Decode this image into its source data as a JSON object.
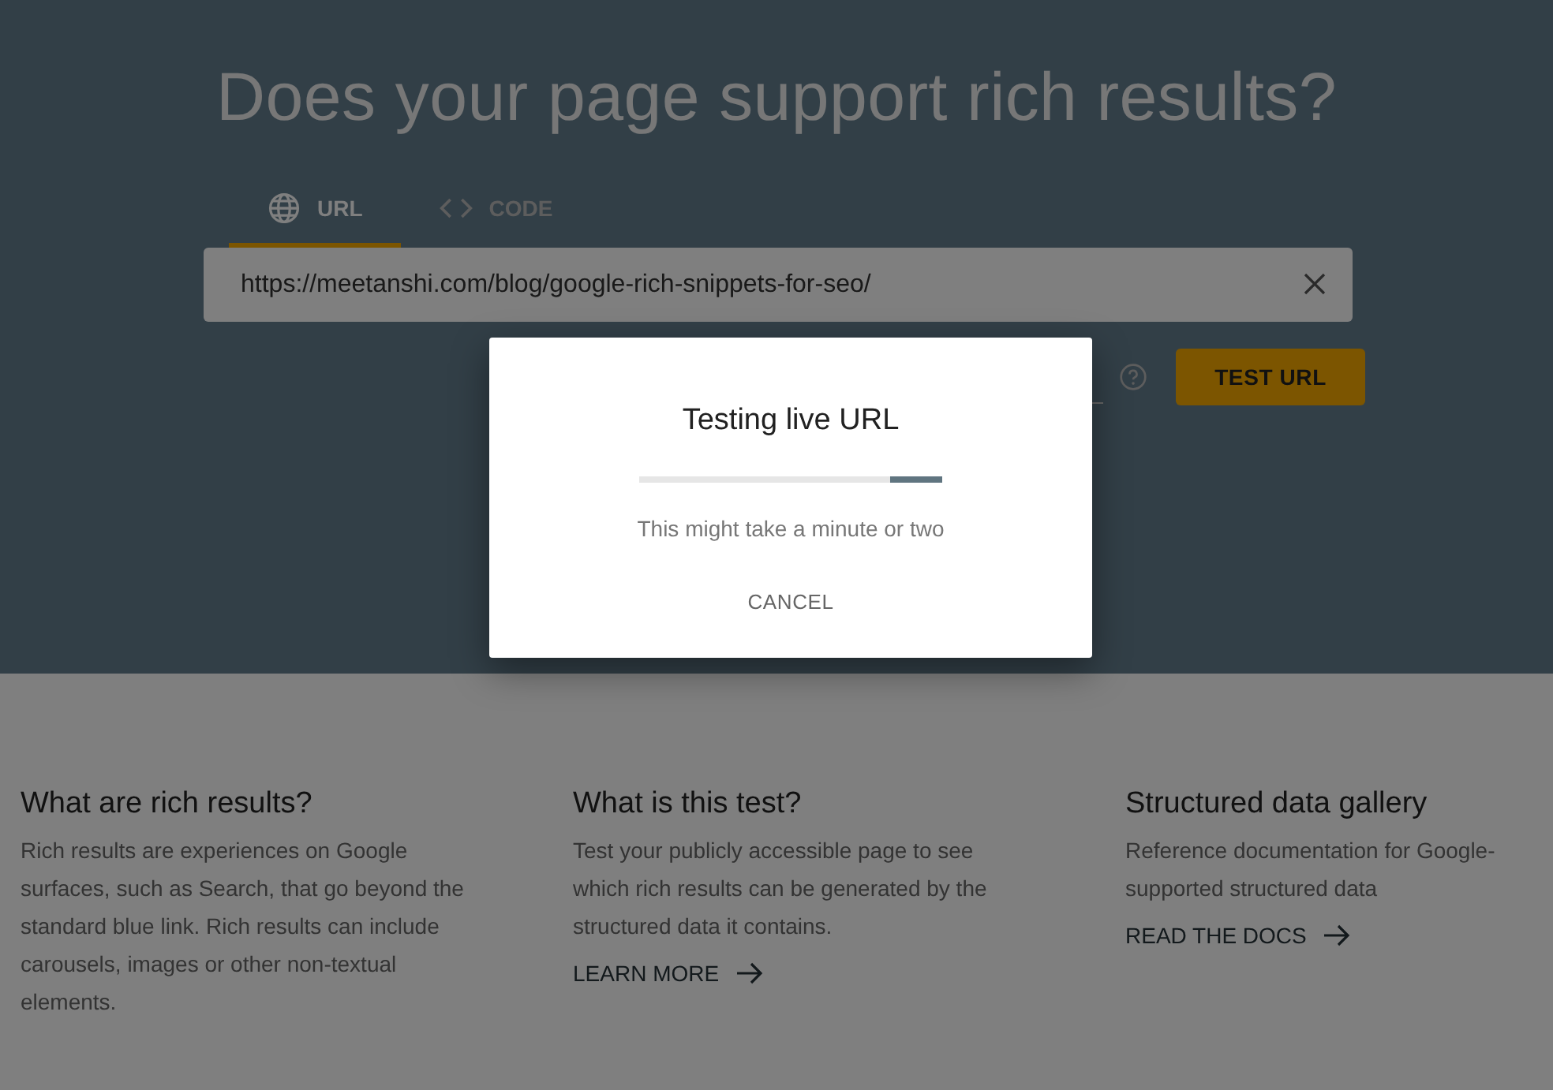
{
  "hero": {
    "title": "Does your page support rich results?",
    "tabs": [
      {
        "label": "URL",
        "kind": "globe",
        "selected": true
      },
      {
        "label": "CODE",
        "kind": "code",
        "selected": false
      }
    ],
    "url_field": {
      "value": "https://meetanshi.com/blog/google-rich-snippets-for-seo/"
    },
    "test_button": "TEST URL"
  },
  "info_columns": [
    {
      "heading": "What are rich results?",
      "body": "Rich results are experiences on Google surfaces, such as Search, that go beyond the standard blue link. Rich results can include carousels, images or other non-textual elements."
    },
    {
      "heading": "What is this test?",
      "body": "Test your publicly accessible page to see which rich results can be generated by the structured data it contains.",
      "link": "LEARN MORE"
    },
    {
      "heading": "Structured data gallery",
      "body": "Reference documentation for Google-supported structured data",
      "link": "READ THE DOCS"
    }
  ],
  "dialog": {
    "title": "Testing live URL",
    "progress": {
      "level": 0.17
    },
    "message": "This might take a minute or two",
    "button": "CANCEL"
  }
}
